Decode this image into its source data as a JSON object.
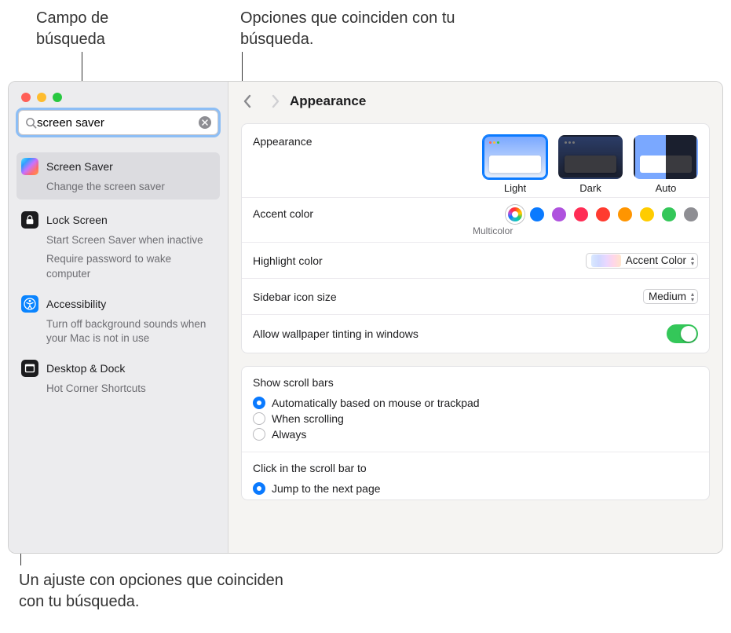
{
  "callouts": {
    "search_field": "Campo de búsqueda",
    "matches": "Opciones que coinciden con tu búsqueda.",
    "setting_group": "Un ajuste con opciones que coinciden con tu búsqueda."
  },
  "search": {
    "query": "screen saver"
  },
  "search_results": [
    {
      "icon": "screensaver",
      "title": "Screen Saver",
      "subs": [
        "Change the screen saver"
      ],
      "selected": true
    },
    {
      "icon": "lock",
      "title": "Lock Screen",
      "subs": [
        "Start Screen Saver when inactive",
        "Require password to wake computer"
      ]
    },
    {
      "icon": "accessibility",
      "title": "Accessibility",
      "subs": [
        "Turn off background sounds when your Mac is not in use"
      ]
    },
    {
      "icon": "desktop",
      "title": "Desktop & Dock",
      "subs": [
        "Hot Corner Shortcuts"
      ]
    }
  ],
  "header": {
    "title": "Appearance"
  },
  "appearance": {
    "row_label": "Appearance",
    "options": [
      {
        "label": "Light",
        "selected": true,
        "variant": "light"
      },
      {
        "label": "Dark",
        "selected": false,
        "variant": "dark"
      },
      {
        "label": "Auto",
        "selected": false,
        "variant": "auto"
      }
    ]
  },
  "accent": {
    "row_label": "Accent color",
    "caption": "Multicolor",
    "colors": [
      "multi",
      "#0a7aff",
      "#af52de",
      "#ff2d55",
      "#ff3b30",
      "#ff9500",
      "#ffcc00",
      "#34c759",
      "#8e8e93"
    ]
  },
  "highlight": {
    "row_label": "Highlight color",
    "value": "Accent Color"
  },
  "sidebar_size": {
    "row_label": "Sidebar icon size",
    "value": "Medium"
  },
  "wallpaper_tint": {
    "row_label": "Allow wallpaper tinting in windows",
    "on": true
  },
  "scrollbars": {
    "title": "Show scroll bars",
    "options": [
      {
        "label": "Automatically based on mouse or trackpad",
        "checked": true
      },
      {
        "label": "When scrolling",
        "checked": false
      },
      {
        "label": "Always",
        "checked": false
      }
    ]
  },
  "click_scroll": {
    "title": "Click in the scroll bar to",
    "options": [
      {
        "label": "Jump to the next page",
        "checked": true
      }
    ]
  }
}
